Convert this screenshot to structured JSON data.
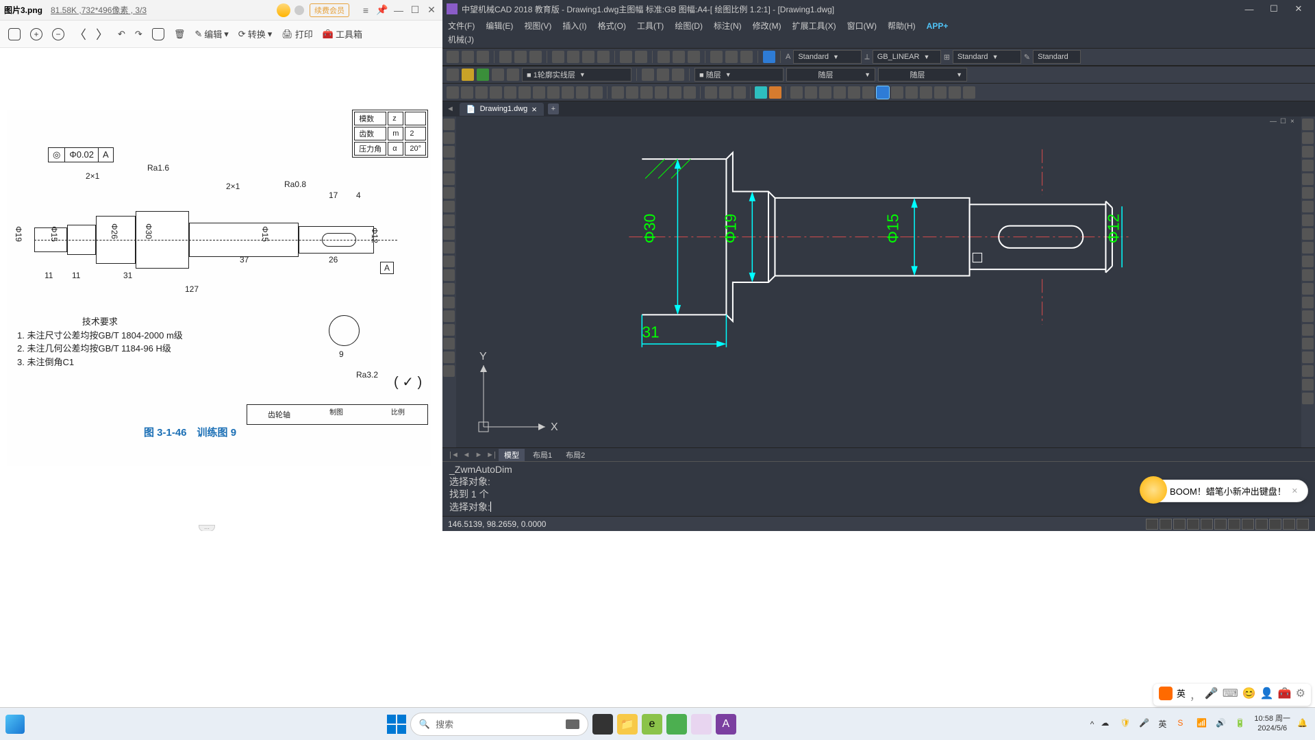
{
  "left_viewer": {
    "filename": "图片3.png",
    "file_info": "81.58K ,732*496像素 , 3/3",
    "vip_label": "续费会员",
    "toolbar": {
      "edit": "编辑",
      "rotate": "转换",
      "print": "打印",
      "toolbox": "工具箱"
    }
  },
  "drawing": {
    "tolerance_sym": "◎",
    "tolerance_val": "Φ0.02",
    "tolerance_datum": "A",
    "chamfer1": "2×1",
    "chamfer2": "2×1",
    "ra1": "Ra1.6",
    "ra2": "Ra0.8",
    "ra3": "Ra3.2",
    "d19": "Φ19",
    "d15": "Φ15",
    "d26": "Φ26",
    "d30": "Φ30",
    "d15b": "Φ15",
    "d12": "Φ12",
    "len11a": "11",
    "len11b": "11",
    "len31": "31",
    "len37": "37",
    "len26": "26",
    "len17": "17",
    "len4": "4",
    "len127": "127",
    "len9": "9",
    "datum_a": "A",
    "tech_title": "技术要求",
    "tech1": "1. 未注尺寸公差均按GB/T 1804-2000 m级",
    "tech2": "2. 未注几何公差均按GB/T 1184-96 H级",
    "tech3": "3. 未注倒角C1",
    "fig_caption": "图 3-1-46　训练图 9",
    "part_name": "齿轮轴",
    "tbl_r1": "模数",
    "tbl_r1v": "z",
    "tbl_r1n": "",
    "tbl_r2": "齿数",
    "tbl_r2v": "m",
    "tbl_r2n": "2",
    "tbl_r3": "压力角",
    "tbl_r3v": "α",
    "tbl_r3n": "20°",
    "block_made": "制图",
    "block_scale": "比例"
  },
  "cad": {
    "title": "中望机械CAD 2018 教育版  - Drawing1.dwg主图幅  标准:GB 图幅:A4-[ 绘图比例 1.2:1] - [Drawing1.dwg]",
    "menus": {
      "file": "文件(F)",
      "edit": "编辑(E)",
      "view": "视图(V)",
      "insert": "插入(I)",
      "format": "格式(O)",
      "tools": "工具(T)",
      "draw": "绘图(D)",
      "dimension": "标注(N)",
      "modify": "修改(M)",
      "ext": "扩展工具(X)",
      "window": "窗口(W)",
      "help": "帮助(H)",
      "app": "APP+",
      "mech": "机械(J)"
    },
    "layer_combo": "■ 1轮廓实线层",
    "color_combo": "■ 随层",
    "linetype_combo": "随层",
    "lineweight_combo": "随层",
    "style_std1": "Standard",
    "style_gb": "GB_LINEAR",
    "style_std2": "Standard",
    "style_std3": "Standard",
    "tab_name": "Drawing1.dwg",
    "dims": {
      "d30": "Φ30",
      "d19": "Φ19",
      "d15": "Φ15",
      "d12": "Φ12",
      "len31": "31"
    },
    "ucs": {
      "x": "X",
      "y": "Y"
    },
    "layout": {
      "model": "模型",
      "layout1": "布局1",
      "layout2": "布局2"
    },
    "cmd": {
      "line1": "_ZwmAutoDim",
      "line2": "选择对象:",
      "line3": "找到 1 个",
      "line4": "选择对象: "
    },
    "status_coords": "146.5139, 98.2659, 0.0000"
  },
  "bubble_text": "BOOM！蜡笔小新冲出键盘！",
  "taskbar": {
    "search_placeholder": "搜索",
    "ime": "英",
    "time": "10:58 周一",
    "date": "2024/5/6"
  }
}
